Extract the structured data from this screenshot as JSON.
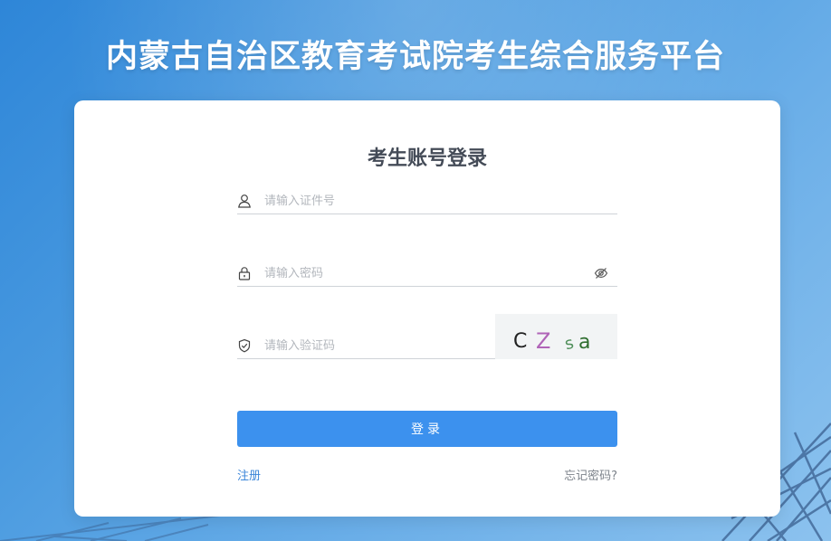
{
  "header": {
    "platform_title": "内蒙古自治区教育考试院考生综合服务平台"
  },
  "login": {
    "heading": "考生账号登录",
    "id_field": {
      "placeholder": "请输入证件号",
      "value": "",
      "icon": "user-icon"
    },
    "password_field": {
      "placeholder": "请输入密码",
      "value": "",
      "icon": "lock-icon",
      "toggle_icon": "eye-off-icon"
    },
    "captcha_field": {
      "placeholder": "请输入验证码",
      "value": "",
      "icon": "shield-icon"
    },
    "captcha_text": "CZsa",
    "submit_label": "登录",
    "register_label": "注册",
    "forgot_label": "忘记密码?"
  },
  "colors": {
    "primary": "#3c91ee",
    "link": "#3c86d9",
    "heading": "#444b57",
    "background": "#4b9be0"
  }
}
